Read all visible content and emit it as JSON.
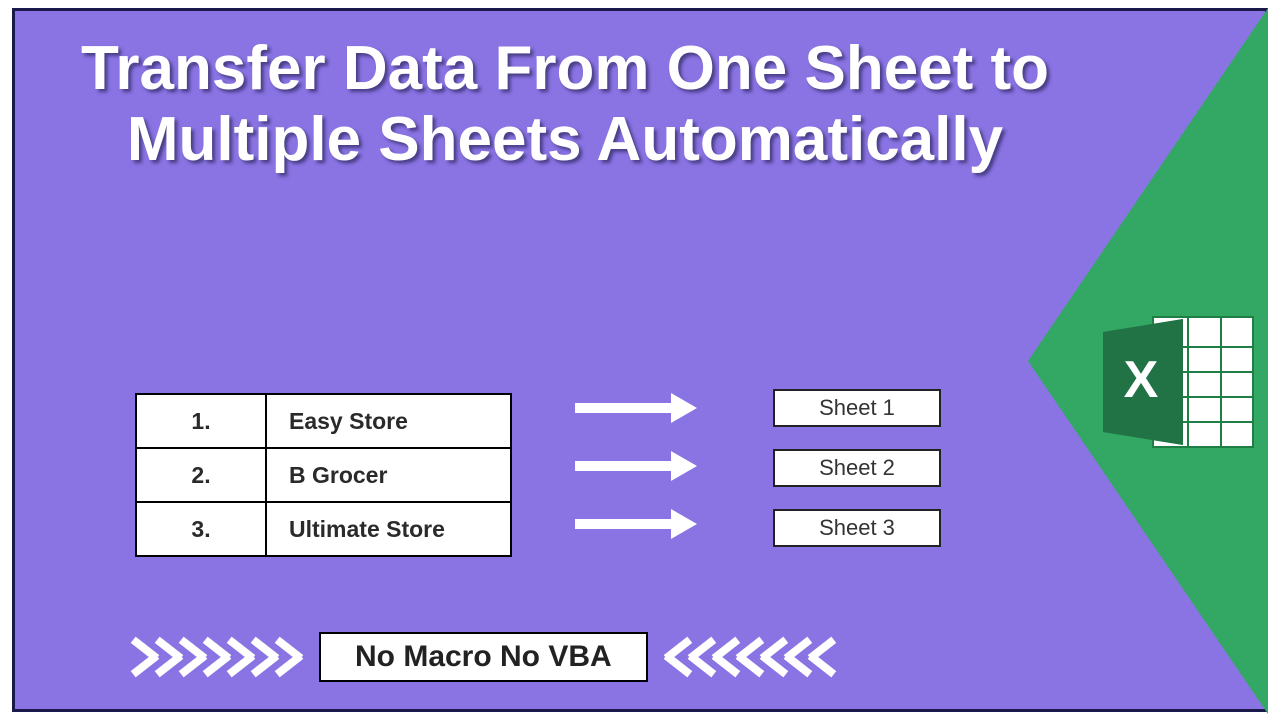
{
  "title": "Transfer Data From One Sheet to Multiple Sheets Automatically",
  "table": {
    "rows": [
      {
        "num": "1.",
        "name": "Easy Store"
      },
      {
        "num": "2.",
        "name": "B Grocer"
      },
      {
        "num": "3.",
        "name": "Ultimate Store"
      }
    ]
  },
  "sheets": [
    "Sheet 1",
    "Sheet 2",
    "Sheet 3"
  ],
  "banner_text": "No Macro No VBA",
  "colors": {
    "background": "#8a73e3",
    "accent_green": "#33a864",
    "border": "#1a1a4a"
  },
  "icons": {
    "excel": "excel-icon"
  }
}
